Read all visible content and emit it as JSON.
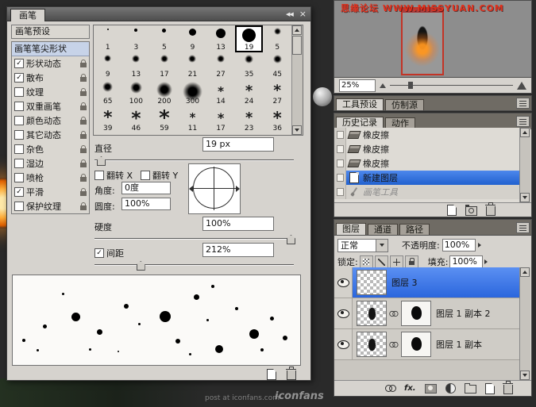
{
  "background": {
    "watermark_text": "post at iconfans.com",
    "watermark_brand": "iconfans"
  },
  "brushes_panel": {
    "tab_label": "画笔",
    "collapse_icon": "◀◀",
    "close_icon": "×",
    "preset_item": "画笔预设",
    "tip_shape_item": "画笔笔尖形状",
    "options": [
      {
        "label": "形状动态",
        "checked": true
      },
      {
        "label": "散布",
        "checked": true
      },
      {
        "label": "纹理",
        "checked": false
      },
      {
        "label": "双重画笔",
        "checked": false
      },
      {
        "label": "颜色动态",
        "checked": false
      },
      {
        "label": "其它动态",
        "checked": false
      },
      {
        "label": "杂色",
        "checked": false
      },
      {
        "label": "湿边",
        "checked": false
      },
      {
        "label": "喷枪",
        "checked": false
      },
      {
        "label": "平滑",
        "checked": true
      },
      {
        "label": "保护纹理",
        "checked": false
      }
    ],
    "selected_index": 5,
    "brushes": [
      {
        "size": 1,
        "type": "hard"
      },
      {
        "size": 3,
        "type": "hard"
      },
      {
        "size": 5,
        "type": "hard"
      },
      {
        "size": 9,
        "type": "hard"
      },
      {
        "size": 13,
        "type": "hard"
      },
      {
        "size": 19,
        "type": "hard"
      },
      {
        "size": 5,
        "type": "soft"
      },
      {
        "size": 9,
        "type": "soft"
      },
      {
        "size": 13,
        "type": "soft"
      },
      {
        "size": 17,
        "type": "soft"
      },
      {
        "size": 21,
        "type": "soft"
      },
      {
        "size": 27,
        "type": "soft"
      },
      {
        "size": 35,
        "type": "soft"
      },
      {
        "size": 45,
        "type": "soft"
      },
      {
        "size": 65,
        "type": "soft"
      },
      {
        "size": 100,
        "type": "soft"
      },
      {
        "size": 200,
        "type": "soft"
      },
      {
        "size": 300,
        "type": "soft"
      },
      {
        "size": 14,
        "type": "sampled"
      },
      {
        "size": 24,
        "type": "sampled"
      },
      {
        "size": 27,
        "type": "sampled"
      },
      {
        "size": 39,
        "type": "sampled"
      },
      {
        "size": 46,
        "type": "sampled"
      },
      {
        "size": 59,
        "type": "sampled"
      },
      {
        "size": 11,
        "type": "sampled"
      },
      {
        "size": 17,
        "type": "sampled"
      },
      {
        "size": 23,
        "type": "sampled"
      },
      {
        "size": 36,
        "type": "sampled"
      }
    ],
    "diameter": {
      "label": "直径",
      "value": "19 px"
    },
    "flip_x_label": "翻转 X",
    "flip_y_label": "翻转 Y",
    "angle": {
      "label": "角度:",
      "value": "0度"
    },
    "roundness": {
      "label": "圆度:",
      "value": "100%"
    },
    "hardness": {
      "label": "硬度",
      "value": "100%"
    },
    "spacing": {
      "label": "间距",
      "value": "212%",
      "checked": true
    },
    "preview_dots": [
      [
        38,
        62,
        5
      ],
      [
        12,
        80,
        4
      ],
      [
        30,
        93,
        3
      ],
      [
        74,
        47,
        11
      ],
      [
        106,
        68,
        7
      ],
      [
        96,
        92,
        3
      ],
      [
        140,
        36,
        6
      ],
      [
        158,
        60,
        3
      ],
      [
        185,
        45,
        14
      ],
      [
        205,
        80,
        6
      ],
      [
        228,
        24,
        7
      ],
      [
        244,
        55,
        3
      ],
      [
        255,
        88,
        10
      ],
      [
        280,
        40,
        4
      ],
      [
        298,
        68,
        12
      ],
      [
        324,
        52,
        5
      ],
      [
        312,
        92,
        4
      ],
      [
        340,
        76,
        6
      ],
      [
        132,
        95,
        2
      ],
      [
        222,
        98,
        3
      ],
      [
        62,
        22,
        3
      ],
      [
        250,
        12,
        4
      ]
    ]
  },
  "navigator": {
    "watermark": "思缘论坛 WWW.MISSYUAN.COM",
    "zoom": "25%"
  },
  "tool_panels": {
    "tabs": [
      "工具预设",
      "仿制源"
    ]
  },
  "history": {
    "tabs": [
      "历史记录",
      "动作"
    ],
    "items": [
      {
        "label": "橡皮擦",
        "icon": "eraser",
        "state": "normal"
      },
      {
        "label": "橡皮擦",
        "icon": "eraser",
        "state": "normal"
      },
      {
        "label": "橡皮擦",
        "icon": "eraser",
        "state": "normal"
      },
      {
        "label": "新建图层",
        "icon": "new-layer",
        "state": "selected"
      },
      {
        "label": "画笔工具",
        "icon": "brush",
        "state": "undone"
      }
    ]
  },
  "layers": {
    "tabs": [
      "图层",
      "通道",
      "路径"
    ],
    "blend_mode": "正常",
    "opacity_label": "不透明度:",
    "opacity_value": "100%",
    "lock_label": "锁定:",
    "fill_label": "填充:",
    "fill_value": "100%",
    "fx_label": "fx.",
    "rows": [
      {
        "name": "图层 3",
        "selected": true,
        "has_mask": false
      },
      {
        "name": "图层 1 副本 2",
        "selected": false,
        "has_mask": true
      },
      {
        "name": "图层 1 副本",
        "selected": false,
        "has_mask": true
      }
    ]
  }
}
